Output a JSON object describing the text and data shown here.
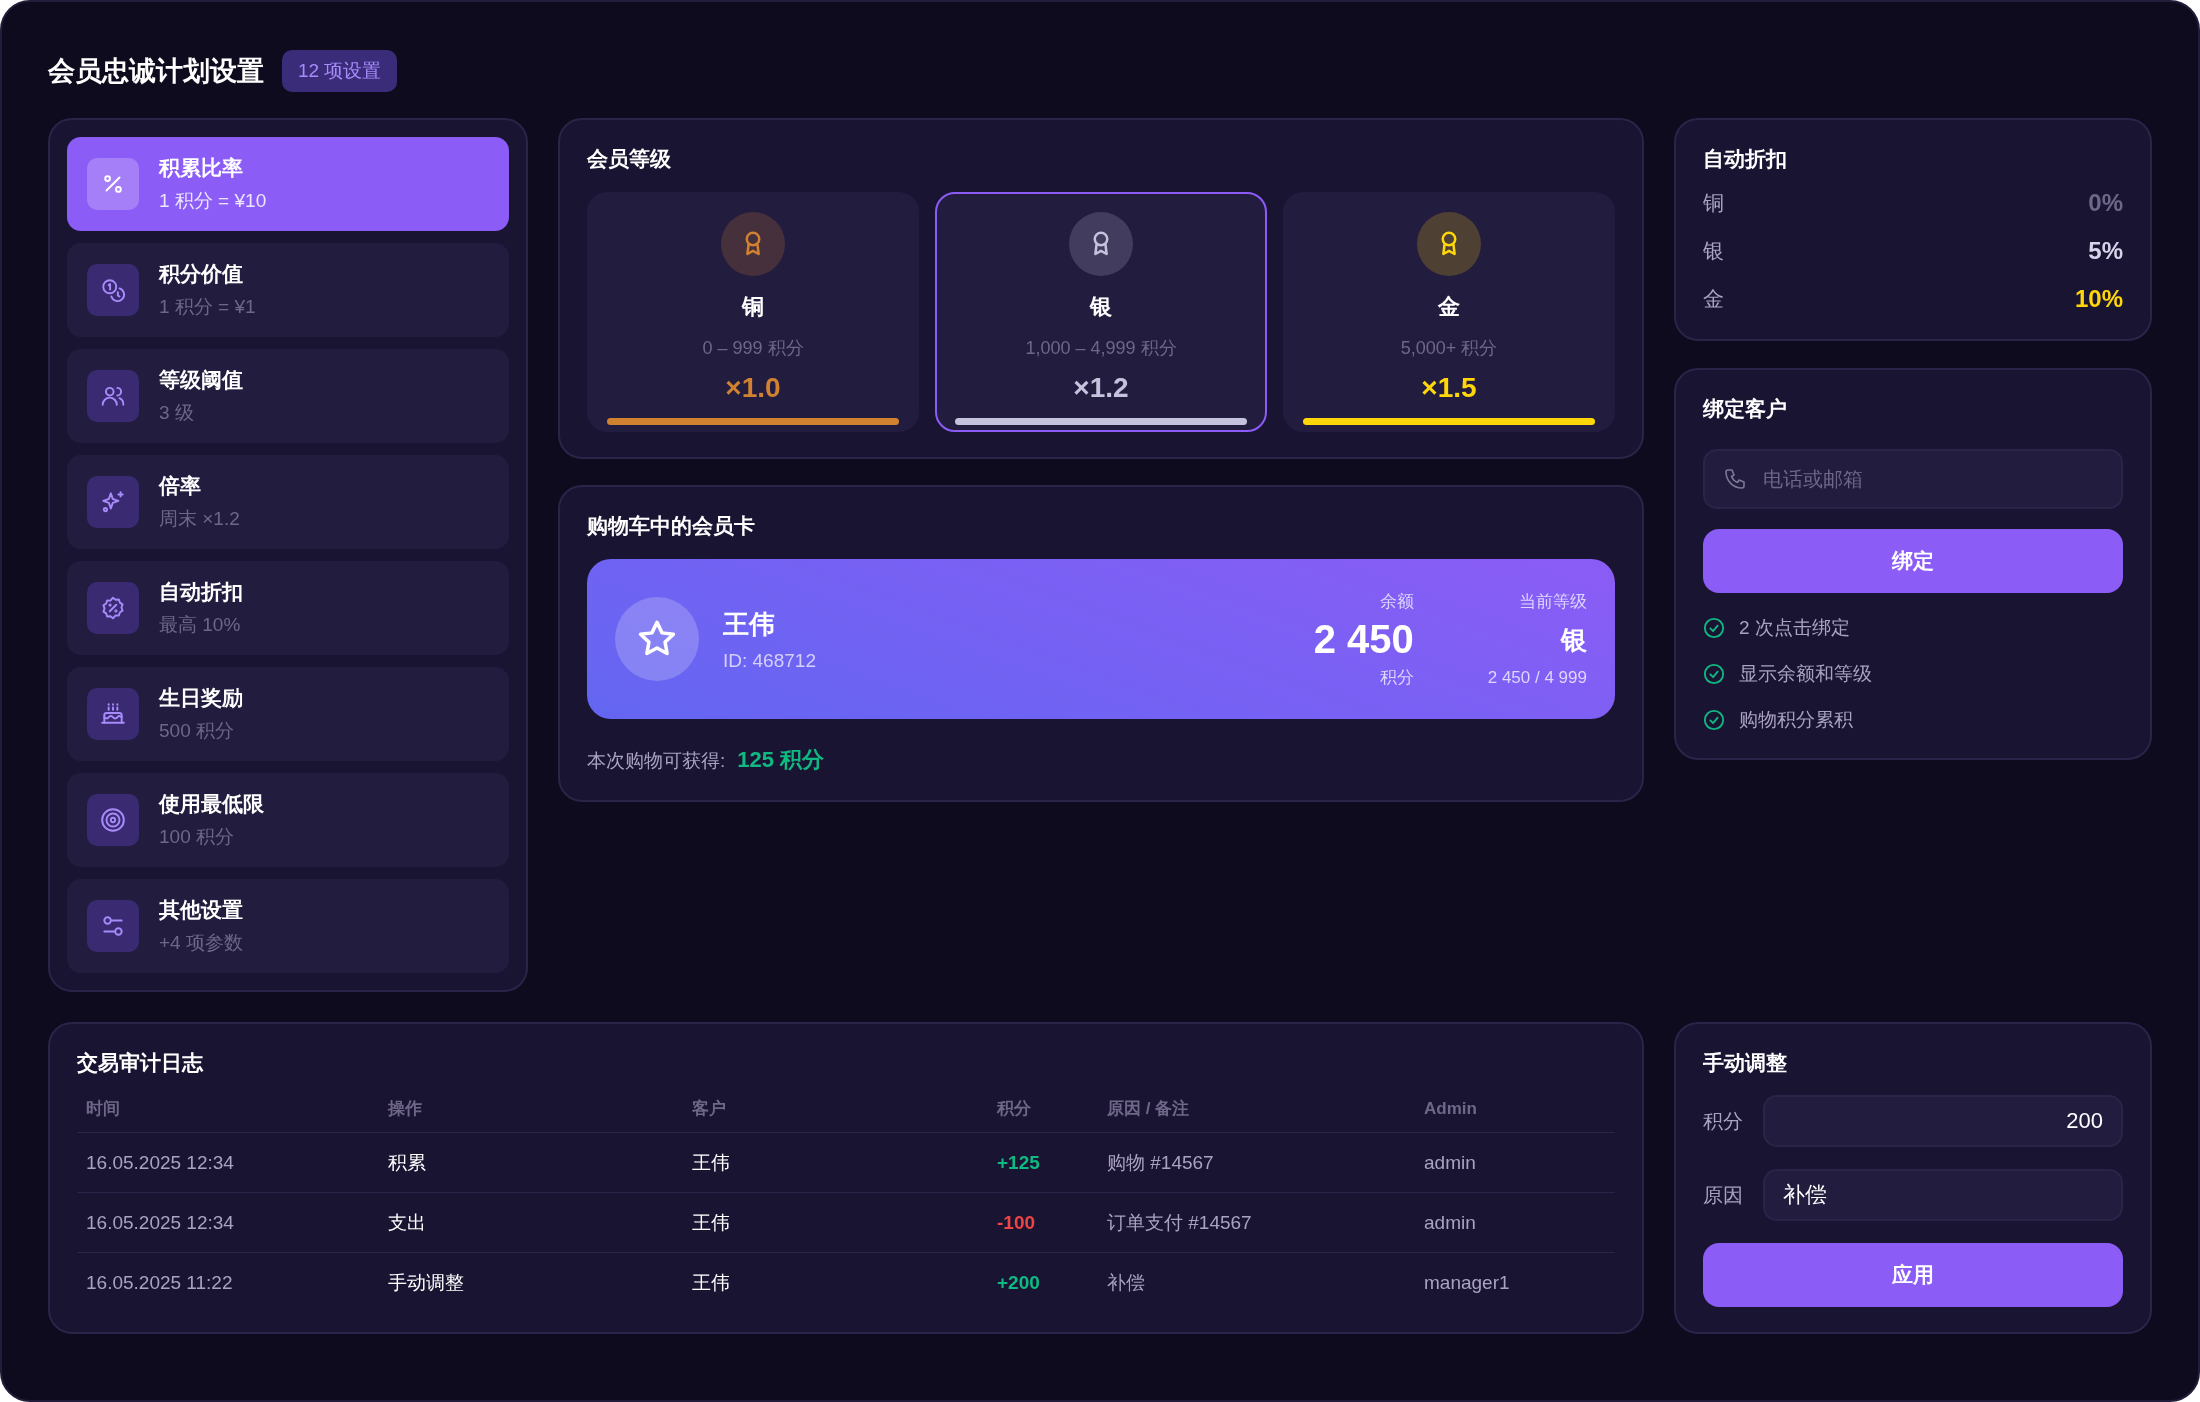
{
  "header": {
    "title": "会员忠诚计划设置",
    "badge": "12 项设置"
  },
  "settings": [
    {
      "title": "积累比率",
      "value": "1 积分 = ¥10",
      "selected": true
    },
    {
      "title": "积分价值",
      "value": "1 积分 = ¥1",
      "selected": false
    },
    {
      "title": "等级阈值",
      "value": "3 级",
      "selected": false
    },
    {
      "title": "倍率",
      "value": "周末 ×1.2",
      "selected": false
    },
    {
      "title": "自动折扣",
      "value": "最高 10%",
      "selected": false
    },
    {
      "title": "生日奖励",
      "value": "500 积分",
      "selected": false
    },
    {
      "title": "使用最低限",
      "value": "100 积分",
      "selected": false
    },
    {
      "title": "其他设置",
      "value": "+4 项参数",
      "selected": false
    }
  ],
  "tiers": {
    "title": "会员等级",
    "items": [
      {
        "name": "铜",
        "range": "0 – 999 积分",
        "multiplier": "×1.0",
        "color": "#d08230",
        "selected": false
      },
      {
        "name": "银",
        "range": "1,000 – 4,999 积分",
        "multiplier": "×1.2",
        "color": "#c4c2dc",
        "selected": true
      },
      {
        "name": "金",
        "range": "5,000+ 积分",
        "multiplier": "×1.5",
        "color": "#ffd60a",
        "selected": false
      }
    ]
  },
  "member_card": {
    "title": "购物车中的会员卡",
    "name": "王伟",
    "id": "ID: 468712",
    "balance_label": "余额",
    "balance": "2 450",
    "balance_unit": "积分",
    "tier_label": "当前等级",
    "tier": "银",
    "progress": "2 450 / 4 999",
    "earn_label": "本次购物可获得:",
    "earn_value": "125 积分"
  },
  "auto_discount": {
    "title": "自动折扣",
    "rows": [
      {
        "tier": "铜",
        "value": "0%",
        "color": "#6e6787"
      },
      {
        "tier": "银",
        "value": "5%",
        "color": "#d6d3e8"
      },
      {
        "tier": "金",
        "value": "10%",
        "color": "#ffd60a"
      }
    ]
  },
  "bind_customer": {
    "title": "绑定客户",
    "placeholder": "电话或邮箱",
    "button": "绑定",
    "features": [
      "2 次点击绑定",
      "显示余额和等级",
      "购物积分累积"
    ]
  },
  "audit_log": {
    "title": "交易审计日志",
    "columns": [
      "时间",
      "操作",
      "客户",
      "积分",
      "原因 / 备注",
      "Admin"
    ],
    "rows": [
      {
        "time": "16.05.2025 12:34",
        "action": "积累",
        "customer": "王伟",
        "points": "+125",
        "kind": "credit",
        "reason": "购物 #14567",
        "admin": "admin"
      },
      {
        "time": "16.05.2025 12:34",
        "action": "支出",
        "customer": "王伟",
        "points": "-100",
        "kind": "debit",
        "reason": "订单支付 #14567",
        "admin": "admin"
      },
      {
        "time": "16.05.2025 11:22",
        "action": "手动调整",
        "customer": "王伟",
        "points": "+200",
        "kind": "credit",
        "reason": "补偿",
        "admin": "manager1"
      }
    ]
  },
  "manual_adjust": {
    "title": "手动调整",
    "points_label": "积分",
    "points_value": "200",
    "reason_label": "原因",
    "reason_value": "补偿",
    "button": "应用"
  }
}
